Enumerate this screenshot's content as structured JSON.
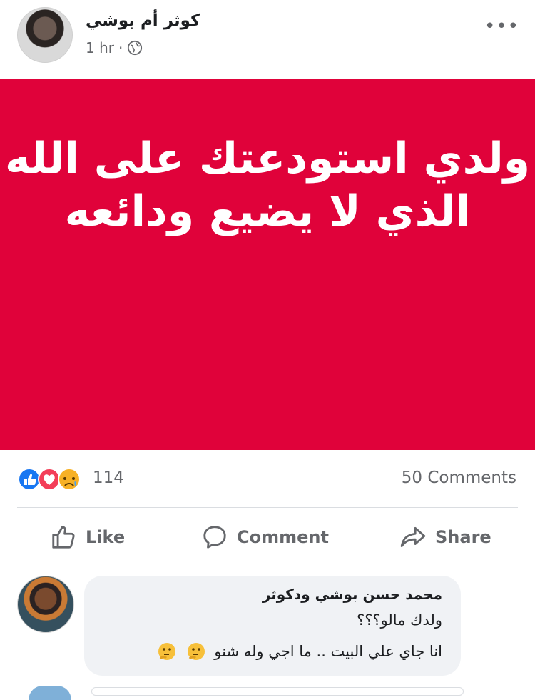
{
  "post": {
    "author": "كوثر أم بوشي",
    "time": "1 hr",
    "separator": "·",
    "privacy_icon": "globe-icon",
    "more_icon": "ellipsis-icon",
    "image_text_line1": "ولدي استودعتك على الله",
    "image_text_line2": "الذي لا يضيع ودائعه",
    "background_color": "#e0023a"
  },
  "reactions": {
    "icons": [
      "like-icon",
      "love-icon",
      "sad-icon"
    ],
    "count": "114",
    "comments": "50 Comments"
  },
  "actions": {
    "like": "Like",
    "comment": "Comment",
    "share": "Share"
  },
  "comment": {
    "name": "محمد حسن بوشي ودكوثر",
    "line1": "ولدك مالو؟؟؟",
    "line2": "انا جاي علي البيت .. ما اجي وله شنو",
    "emoji_icon": "thinking-face-icon"
  }
}
